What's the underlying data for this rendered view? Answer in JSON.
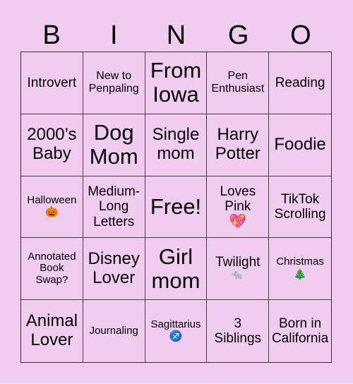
{
  "header": {
    "letters": [
      "B",
      "I",
      "N",
      "G",
      "O"
    ]
  },
  "colors": {
    "background": "#f0ccf0",
    "grid_line": "#3a2a3a",
    "text": "#000000"
  },
  "cells": [
    {
      "text": "Introvert",
      "emoji": ""
    },
    {
      "text": "New to\nPenpaling",
      "emoji": ""
    },
    {
      "text": "From\nIowa",
      "emoji": ""
    },
    {
      "text": "Pen\nEnthusiast",
      "emoji": ""
    },
    {
      "text": "Reading",
      "emoji": ""
    },
    {
      "text": "2000’s\nBaby",
      "emoji": ""
    },
    {
      "text": "Dog\nMom",
      "emoji": ""
    },
    {
      "text": "Single\nmom",
      "emoji": ""
    },
    {
      "text": "Harry\nPotter",
      "emoji": ""
    },
    {
      "text": "Foodie",
      "emoji": ""
    },
    {
      "text": "Halloween",
      "emoji": "🎃"
    },
    {
      "text": "Medium-\nLong\nLetters",
      "emoji": ""
    },
    {
      "text": "Free!",
      "emoji": ""
    },
    {
      "text": "Loves\nPink",
      "emoji": "💖"
    },
    {
      "text": "TikTok\nScrolling",
      "emoji": ""
    },
    {
      "text": "Annotated\nBook\nSwap?",
      "emoji": ""
    },
    {
      "text": "Disney\nLover",
      "emoji": ""
    },
    {
      "text": "Girl\nmom",
      "emoji": ""
    },
    {
      "text": "Twilight",
      "emoji": "🐀"
    },
    {
      "text": "Christmas",
      "emoji": "🎄"
    },
    {
      "text": "Animal\nLover",
      "emoji": ""
    },
    {
      "text": "Journaling",
      "emoji": ""
    },
    {
      "text": "Sagittarius",
      "emoji": "♐"
    },
    {
      "text": "3\nSiblings",
      "emoji": ""
    },
    {
      "text": "Born in\nCalifornia",
      "emoji": ""
    }
  ]
}
